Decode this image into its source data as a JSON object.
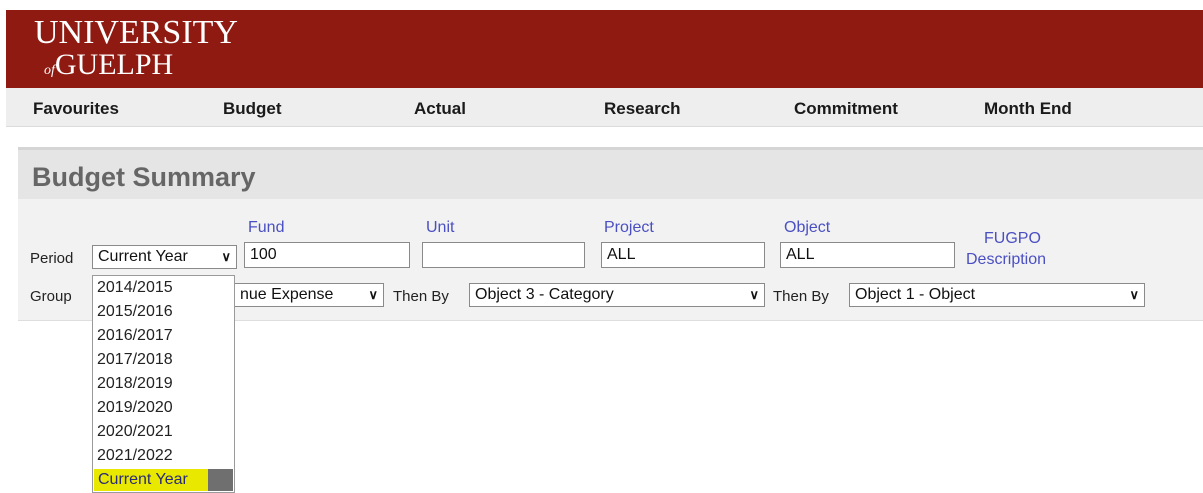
{
  "logo": {
    "line1": "UNIVERSITY",
    "of": "of",
    "line2": "GUELPH"
  },
  "nav": [
    "Favourites",
    "Budget",
    "Actual",
    "Research",
    "Commitment",
    "Month End"
  ],
  "page_title": "Budget Summary",
  "filters": {
    "period_label": "Period",
    "period_value": "Current Year",
    "fund_label": "Fund",
    "fund_value": "100",
    "unit_label": "Unit",
    "unit_value": "",
    "project_label": "Project",
    "project_value": "ALL",
    "object_label": "Object",
    "object_value": "ALL",
    "fugpo_line1": "FUGPO",
    "fugpo_line2": "Description",
    "group_label": "Group",
    "group_value_partial": "nue Expense",
    "then_by_label_1": "Then By",
    "then_by_value_1": "Object 3 - Category",
    "then_by_label_2": "Then By",
    "then_by_value_2": "Object 1 - Object"
  },
  "period_options": [
    "2014/2015",
    "2015/2016",
    "2016/2017",
    "2017/2018",
    "2018/2019",
    "2019/2020",
    "2020/2021",
    "2021/2022",
    "Current Year"
  ],
  "colors": {
    "banner": "#8f1a12",
    "link": "#4a4fc2",
    "highlight": "#e8e800"
  }
}
